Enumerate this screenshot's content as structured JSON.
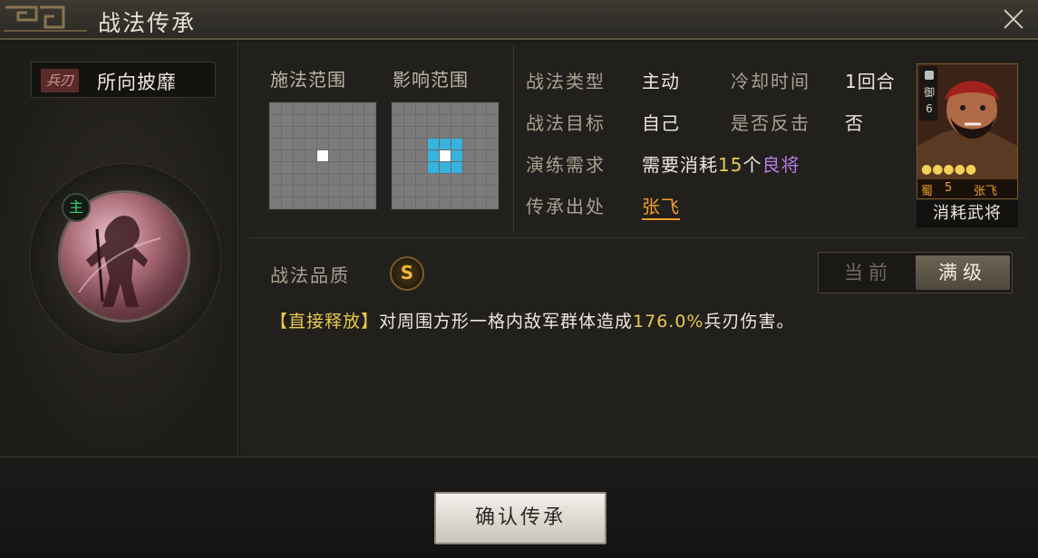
{
  "window": {
    "title": "战法传承"
  },
  "skill": {
    "type_tag": "兵刃",
    "name": "所向披靡",
    "main_badge": "主",
    "quality_label": "战法品质",
    "quality_grade": "S"
  },
  "ranges": {
    "cast_label": "施法范围",
    "effect_label": "影响范围",
    "grid_size": 9,
    "cast_center": [
      4,
      4
    ],
    "effect_center": [
      4,
      4
    ],
    "effect_radius": 1
  },
  "info": {
    "type_label": "战法类型",
    "type_value": "主动",
    "cooldown_label": "冷却时间",
    "cooldown_value": "1回合",
    "target_label": "战法目标",
    "target_value": "自己",
    "counter_label": "是否反击",
    "counter_value": "否",
    "train_label": "演练需求",
    "train_prefix": "需要消耗",
    "train_count": "15",
    "train_unit": "个",
    "train_name": "良将",
    "source_label": "传承出处",
    "source_value": "张飞"
  },
  "hero_card": {
    "troop": "御",
    "cost": "6",
    "stars": "●●●●●",
    "faction": "蜀",
    "level": "5",
    "name": "张飞",
    "caption": "消耗武将"
  },
  "toggle": {
    "current": "当前",
    "max": "满级",
    "selected": "max"
  },
  "description": {
    "tag": "【直接释放】",
    "text1": "对周围方形一格内敌军群体造成",
    "percent": "176.0%",
    "text2": "兵刃伤害。"
  },
  "confirm_label": "确认传承",
  "colors": {
    "accent_yellow": "#e7c950",
    "accent_orange": "#f0a028",
    "purple": "#b57ce2",
    "grid_blue": "#37b3e0"
  }
}
